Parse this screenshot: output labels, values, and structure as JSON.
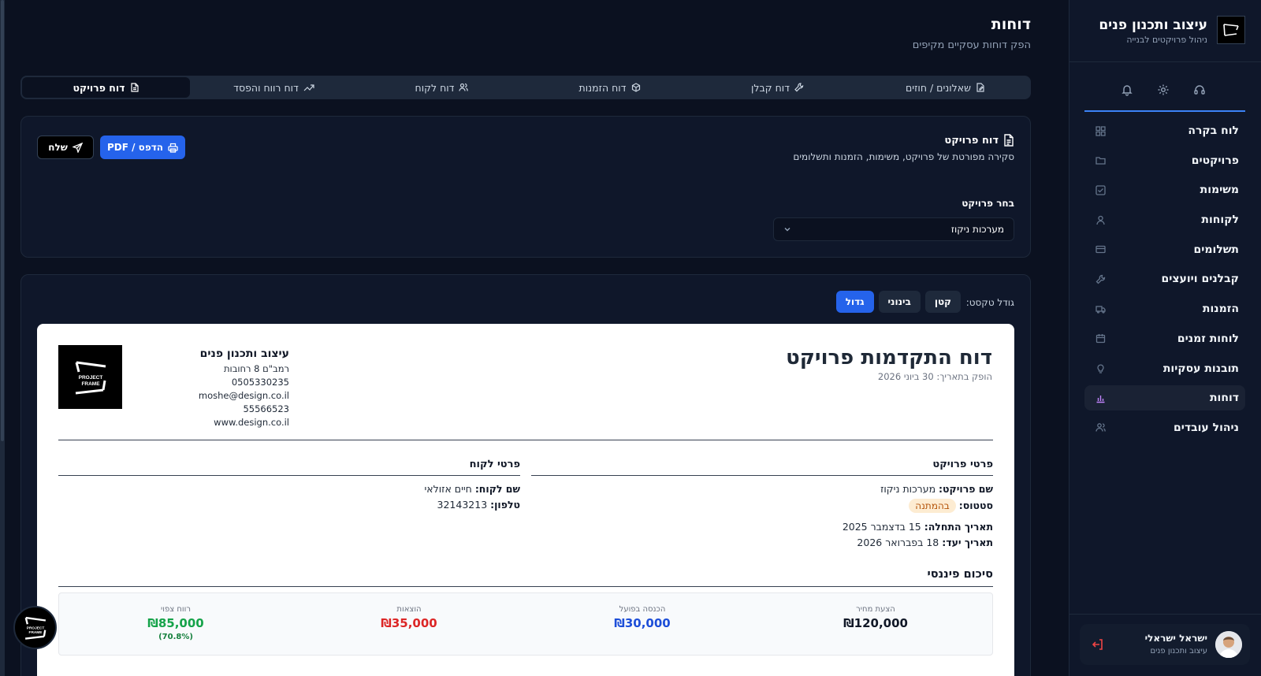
{
  "sidebar": {
    "brand_title": "עיצוב ותכנון פנים",
    "brand_sub": "ניהול פרויקטים לבנייה",
    "logo_text": "PROJECT FRAME",
    "tool_icons": [
      "headset-icon",
      "gear-icon",
      "bell-icon"
    ],
    "items": [
      {
        "label": "לוח בקרה",
        "icon": "grid-icon"
      },
      {
        "label": "פרויקטים",
        "icon": "folder-icon"
      },
      {
        "label": "משימות",
        "icon": "checkbox-icon"
      },
      {
        "label": "לקוחות",
        "icon": "user-icon"
      },
      {
        "label": "תשלומים",
        "icon": "card-icon"
      },
      {
        "label": "קבלנים ויועצים",
        "icon": "wrench-icon"
      },
      {
        "label": "הזמנות",
        "icon": "truck-icon"
      },
      {
        "label": "לוחות זמנים",
        "icon": "calendar-icon"
      },
      {
        "label": "תובנות עסקיות",
        "icon": "bulb-icon"
      },
      {
        "label": "דוחות",
        "icon": "bar-chart-icon"
      },
      {
        "label": "ניהול עובדים",
        "icon": "users-icon"
      }
    ],
    "active_item": "דוחות",
    "user": {
      "name": "ישראל ישראלי",
      "org": "עיצוב ותכנון פנים"
    }
  },
  "header": {
    "title": "דוחות",
    "subtitle": "הפק דוחות עסקיים מקיפים"
  },
  "tabs": [
    {
      "label": "שאלונים / חוזים",
      "icon": "doc-edit-icon"
    },
    {
      "label": "דוח קבלן",
      "icon": "wrench-icon"
    },
    {
      "label": "דוח הזמנות",
      "icon": "box-icon"
    },
    {
      "label": "דוח לקוח",
      "icon": "users-icon"
    },
    {
      "label": "דוח רווח והפסד",
      "icon": "trend-icon"
    },
    {
      "label": "דוח פרויקט",
      "icon": "file-icon"
    }
  ],
  "active_tab": "דוח פרויקט",
  "report_card": {
    "title": "דוח פרויקט",
    "subtitle": "סקירה מפורטת של פרויקט, משימות, הזמנות ותשלומים",
    "print_button": "הדפס / PDF",
    "send_button": "שלח",
    "select_label": "בחר פרויקט",
    "select_value": "מערכות ניקוז"
  },
  "text_size": {
    "label": "גודל טקסט:",
    "options": [
      "קטן",
      "בינוני",
      "גדול"
    ],
    "active": "גדול"
  },
  "report": {
    "title": "דוח התקדמות פרויקט",
    "issued": "הופק בתאריך: 30 ביוני 2026",
    "company": {
      "name": "עיצוב ותכנון פנים",
      "address": "רמב\"ם 8 רחובות",
      "phone": "0505330235",
      "email": "moshe@design.co.il",
      "id": "55566523",
      "website": "www.design.co.il"
    },
    "project_section": {
      "heading": "פרטי פרויקט",
      "name_label": "שם פרויקט:",
      "name_value": "מערכות ניקוז",
      "status_label": "סטטוס:",
      "status_value": "בהמתנה",
      "start_label": "תאריך התחלה:",
      "start_value": "15 בדצמבר 2025",
      "due_label": "תאריך יעד:",
      "due_value": "18 בפברואר 2026"
    },
    "client_section": {
      "heading": "פרטי לקוח",
      "name_label": "שם לקוח:",
      "name_value": "חיים אזולאי",
      "phone_label": "טלפון:",
      "phone_value": "32143213"
    },
    "financial": {
      "heading": "סיכום פיננסי",
      "items": [
        {
          "label": "הצעת מחיר",
          "value": "₪120,000",
          "color": "#111827"
        },
        {
          "label": "הכנסה בפועל",
          "value": "₪30,000",
          "color": "#1d4ed8"
        },
        {
          "label": "הוצאות",
          "value": "₪35,000",
          "color": "#dc2626"
        },
        {
          "label": "רווח צפוי",
          "value": "₪85,000",
          "color": "#16a34a",
          "note": "(70.8%)"
        }
      ]
    }
  }
}
